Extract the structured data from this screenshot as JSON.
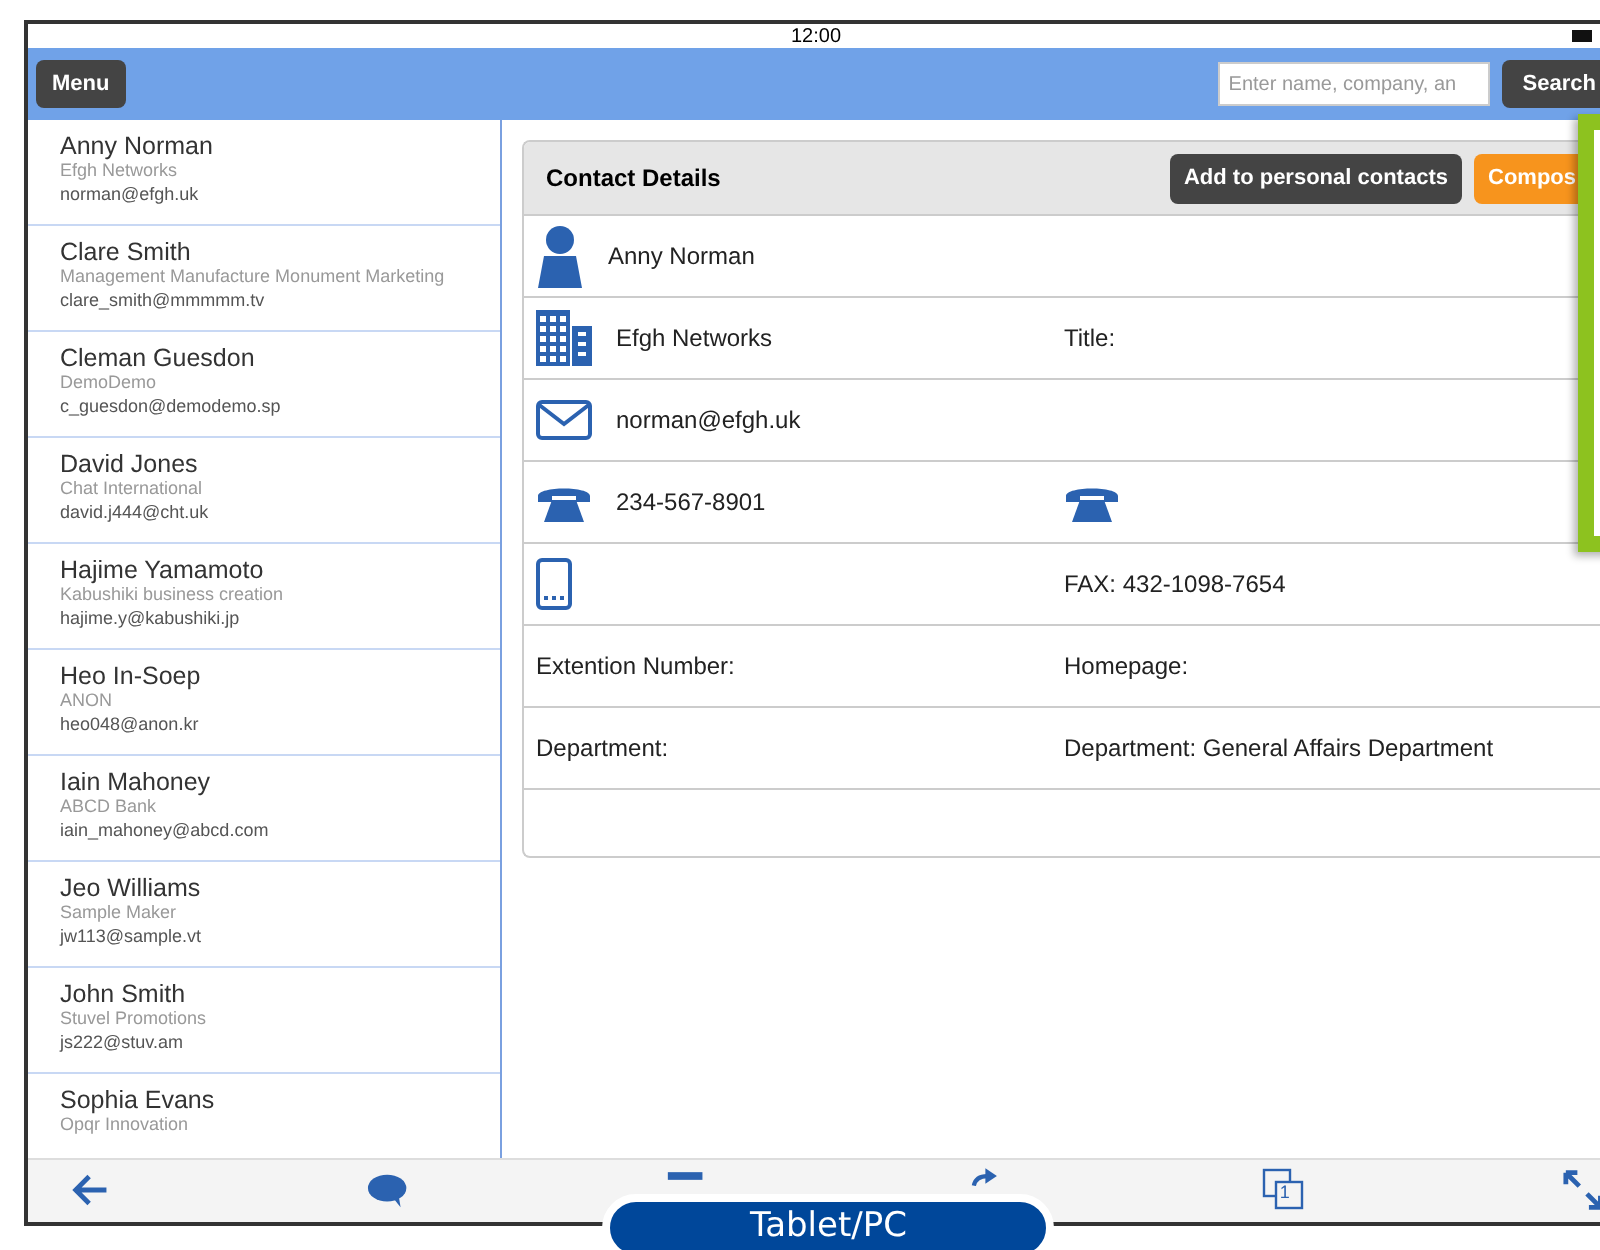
{
  "status_bar": {
    "time": "12:00"
  },
  "toolbar": {
    "menu_button": "Menu",
    "search": {
      "placeholder": "Enter name, company, an"
    },
    "search_button": "Search"
  },
  "contacts": [
    {
      "name": "Anny Norman",
      "company": "Efgh Networks",
      "email": "norman@efgh.uk",
      "selected": false
    },
    {
      "name": "Clare Smith",
      "company": "Management Manufacture Monument Marketing",
      "email": "clare_smith@mmmmm.tv",
      "selected": false
    },
    {
      "name": "Cleman Guesdon",
      "company": "DemoDemo",
      "email": "c_guesdon@demodemo.sp",
      "selected": false
    },
    {
      "name": "David Jones",
      "company": "Chat International",
      "email": "david.j444@cht.uk",
      "selected": false
    },
    {
      "name": "Hajime Yamamoto",
      "company": "Kabushiki business creation",
      "email": "hajime.y@kabushiki.jp",
      "selected": false
    },
    {
      "name": "Heo In-Soep",
      "company": "ANON",
      "email": "heo048@anon.kr",
      "selected": false
    },
    {
      "name": "Iain Mahoney",
      "company": "ABCD Bank",
      "email": "iain_mahoney@abcd.com",
      "selected": false
    },
    {
      "name": "Jeo Williams",
      "company": "Sample Maker",
      "email": "jw113@sample.vt",
      "selected": false
    },
    {
      "name": "John Smith",
      "company": "Stuvel Promotions",
      "email": "js222@stuv.am",
      "selected": false
    },
    {
      "name": "Sophia Evans",
      "company": "Opqr Innovation",
      "selected": false
    }
  ],
  "details": {
    "title": "Contact Details",
    "add_button": "Add to personal contacts",
    "compose_button": "Compos",
    "rows": [
      {
        "kind": "person",
        "left_text": "Anny Norman"
      },
      {
        "kind": "company",
        "left_text": "Efgh Networks",
        "right_text": "Title:"
      },
      {
        "kind": "email",
        "left_text": "norman@efgh.uk"
      },
      {
        "kind": "phone",
        "left_text": "234-567-8901"
      },
      {
        "kind": "mobile",
        "right_text": "FAX: 432-1098-7654"
      },
      {
        "kind": "plain",
        "left_text": "Extention Number:",
        "right_text": "Homepage:"
      },
      {
        "kind": "plain",
        "left_text": "Department:",
        "right_text": "Department: General Affairs Department"
      }
    ]
  },
  "bottom_bar": {
    "page_count": "1"
  },
  "caption": "Tablet/PC"
}
